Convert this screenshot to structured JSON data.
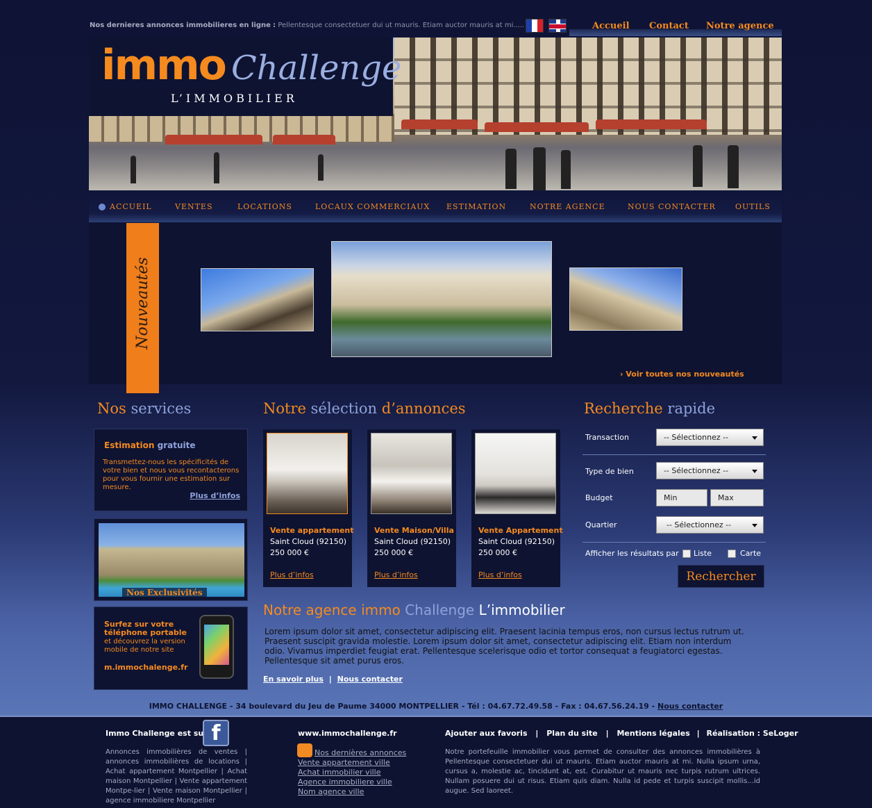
{
  "topbar": {
    "headline": "Nos dernieres annonces immobilieres en ligne",
    "separator": ":",
    "ticker": "Pellentesque consectetuer dui ut mauris. Etiam auctor mauris at mi.....",
    "links": [
      "Accueil",
      "Contact",
      "Notre agence"
    ]
  },
  "logo": {
    "immo": "immo",
    "challenge": "Challenge",
    "sub": "L’IMMOBILIER"
  },
  "menu": [
    "ACCUEIL",
    "VENTES",
    "LOCATIONS",
    "LOCAUX COMMERCIAUX",
    "ESTIMATION",
    "NOTRE AGENCE",
    "NOUS CONTACTER",
    "OUTILS"
  ],
  "news": {
    "ribbon": "Nouveautés",
    "more": "› Voir toutes nos nouveautés"
  },
  "services": {
    "title_a": "Nos",
    "title_b": "services",
    "estimation": {
      "title_a": "Estimation",
      "title_b": "gratuite",
      "text": "Transmettez-nous les spécificités de votre bien et nous vous recontacterons pour vous fournir une estimation sur mesure.",
      "more": "Plus d’infos"
    },
    "exclusivites": "Nos Exclusivités",
    "mobile": {
      "title": "Surfez sur votre téléphone portable",
      "text": "et découvrez la version mobile de notre site",
      "url": "m.immochalenge.fr"
    }
  },
  "annonces": {
    "title_a": "Notre",
    "title_b": "sélection",
    "title_c": "d’annonces",
    "cards": [
      {
        "title": "Vente appartement",
        "location": "Saint Cloud  (92150)",
        "price": "250 000 €",
        "more": "Plus d’infos"
      },
      {
        "title": "Vente Maison/Villa",
        "location": "Saint Cloud  (92150)",
        "price": "250 000 €",
        "more": "Plus d’infos"
      },
      {
        "title": "Vente Appartement",
        "location": "Saint Cloud  (92150)",
        "price": "250 000 €",
        "more": "Plus d’infos"
      }
    ]
  },
  "recherche": {
    "title_a": "Recherche",
    "title_b": "rapide",
    "transaction_label": "Transaction",
    "transaction_value": "-- Sélectionnez --",
    "type_label": "Type de bien",
    "type_value": "-- Sélectionnez --",
    "budget_label": "Budget",
    "min": "Min",
    "max": "Max",
    "quartier_label": "Quartier",
    "quartier_value": "-- Sélectionnez --",
    "afficher_label": "Afficher les résultats par",
    "liste": "Liste",
    "carte": "Carte",
    "button": "Rechercher"
  },
  "agence": {
    "title_a": "Notre agence immo",
    "title_b": "Challenge",
    "title_c": "L’immobilier",
    "text": "Lorem ipsum dolor sit amet, consectetur adipiscing elit. Praesent lacinia tempus eros, non cursus lectus rutrum ut. Praesent suscipit gravida molestie. Lorem ipsum dolor sit amet, consectetur adipiscing elit. Etiam non interdum odio. Vivamus imperdiet feugiat erat. Pellentesque scelerisque odio et tortor consequat a feugiatorci egestas. Pellentesque sit amet purus eros.",
    "en_savoir": "En savoir plus",
    "sep": "|",
    "contact": "Nous contacter"
  },
  "address": {
    "text": "IMMO CHALLENGE - 34 boulevard du Jeu de Paume 34000 MONTPELLIER - Tél : 04.67.72.49.58 - Fax : 04.67.56.24.19 -",
    "link": "Nous contacter"
  },
  "footer": {
    "fb_title": "Immo Challenge est sur",
    "fb_icon": "f",
    "col1_text": "Annonces immobilières de ventes | annonces immobilières de locations | Achat appartement Montpellier | Achat maison Montpellier | Vente appartement Montpe-lier | Vente maison Montpellier | agence immobiliere Montpellier",
    "site": "www.immochallenge.fr",
    "links": [
      "Nos dernières annonces",
      "Vente appartement ville",
      "Achat immobilier ville",
      "Agence immobiliere ville",
      "Nom agence ville"
    ],
    "top_links": [
      "Ajouter aux favoris",
      "Plan du site",
      "Mentions légales",
      "Réalisation : SeLoger"
    ],
    "top_sep": "|",
    "col3_text": "Notre portefeuille immobilier vous permet de consulter des annonces immobilières à Pellentesque consectetuer dui ut mauris. Etiam auctor mauris at mi. Nulla ipsum urna, cursus a, molestie ac, tincidunt at, est. Curabitur ut mauris nec turpis rutrum ultrices. Nullam posuere dui ut risus. Etiam quis diam. Nulla id pede et turpis suscipit mollis...id augue. Sed laoreet."
  }
}
